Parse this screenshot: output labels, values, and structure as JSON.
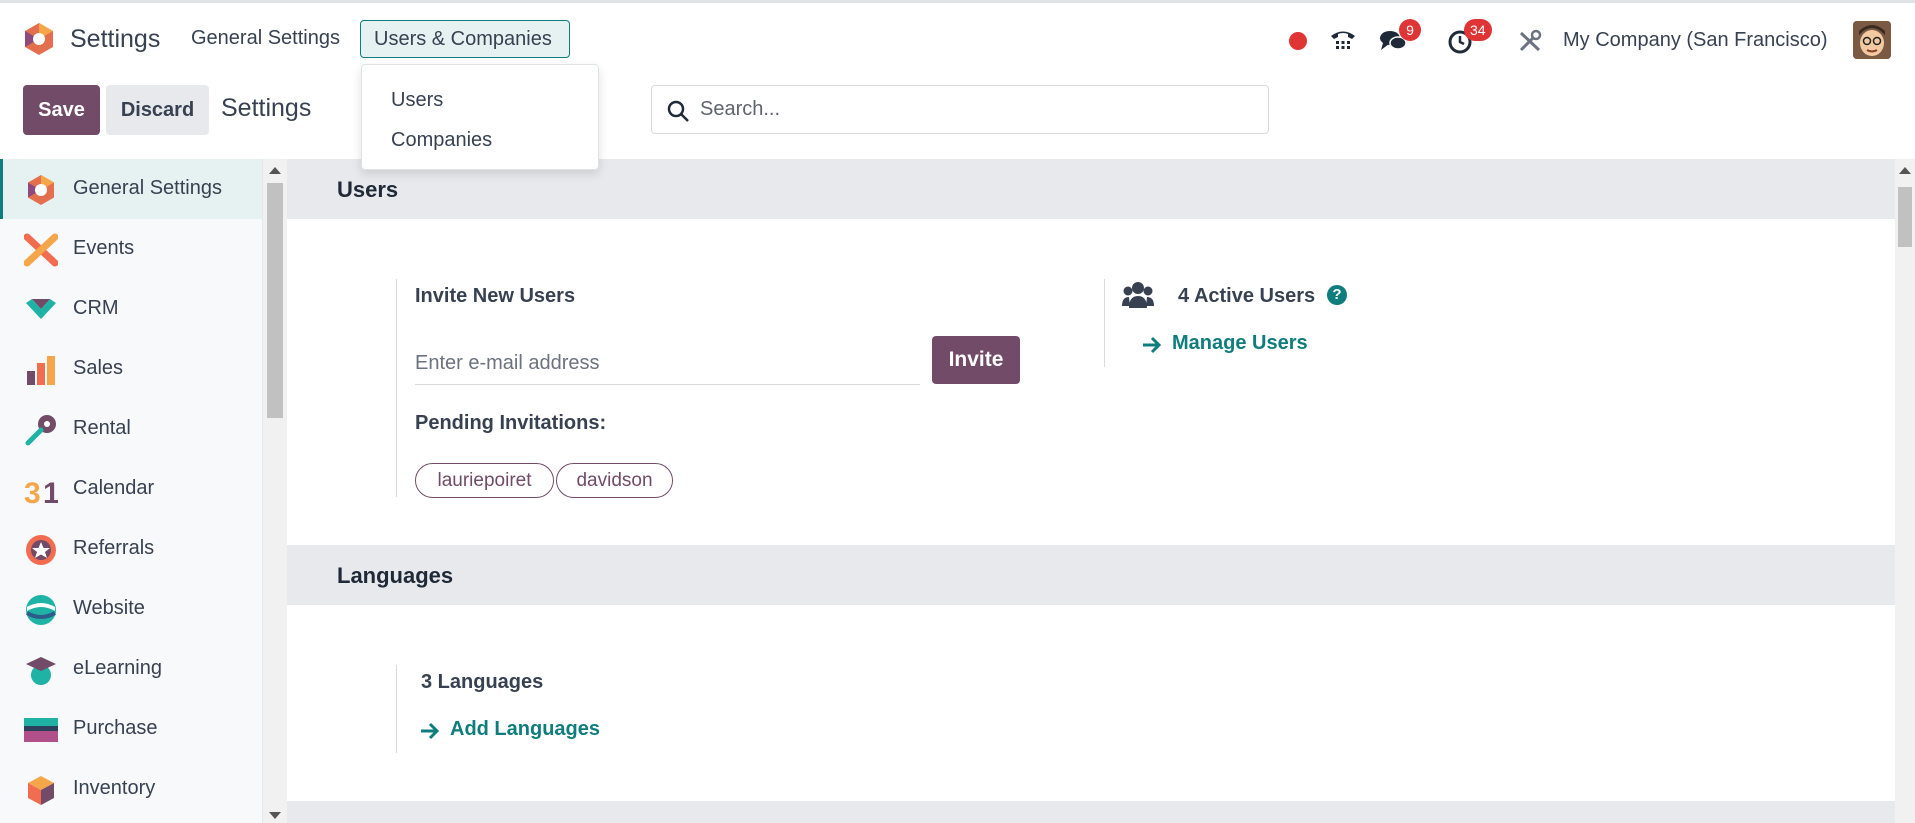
{
  "navbar": {
    "app_name": "Settings",
    "menus": [
      "General Settings",
      "Users & Companies"
    ],
    "messages_badge": "9",
    "activities_badge": "34",
    "company": "My Company (San Francisco)"
  },
  "dropdown": {
    "items": [
      "Users",
      "Companies"
    ]
  },
  "control": {
    "save_label": "Save",
    "discard_label": "Discard",
    "breadcrumb": "Settings",
    "search_placeholder": "Search..."
  },
  "sidebar": {
    "items": [
      {
        "label": "General Settings",
        "icon": "settings-icon"
      },
      {
        "label": "Events",
        "icon": "events-icon"
      },
      {
        "label": "CRM",
        "icon": "crm-icon"
      },
      {
        "label": "Sales",
        "icon": "sales-icon"
      },
      {
        "label": "Rental",
        "icon": "rental-icon"
      },
      {
        "label": "Calendar",
        "icon": "calendar-icon"
      },
      {
        "label": "Referrals",
        "icon": "referrals-icon"
      },
      {
        "label": "Website",
        "icon": "website-icon"
      },
      {
        "label": "eLearning",
        "icon": "elearning-icon"
      },
      {
        "label": "Purchase",
        "icon": "purchase-icon"
      },
      {
        "label": "Inventory",
        "icon": "inventory-icon"
      }
    ]
  },
  "users_section": {
    "title": "Users",
    "invite_label": "Invite New Users",
    "email_placeholder": "Enter e-mail address",
    "invite_button": "Invite",
    "pending_label": "Pending Invitations:",
    "pending": [
      "lauriepoiret",
      "davidson"
    ],
    "active_users": "4 Active Users",
    "help": "?",
    "manage_users": "Manage Users"
  },
  "languages_section": {
    "title": "Languages",
    "count": "3 Languages",
    "add_languages": "Add Languages"
  },
  "colors": {
    "primary": "#714b67",
    "accent": "#0f7d7e",
    "badge": "#e03535"
  }
}
